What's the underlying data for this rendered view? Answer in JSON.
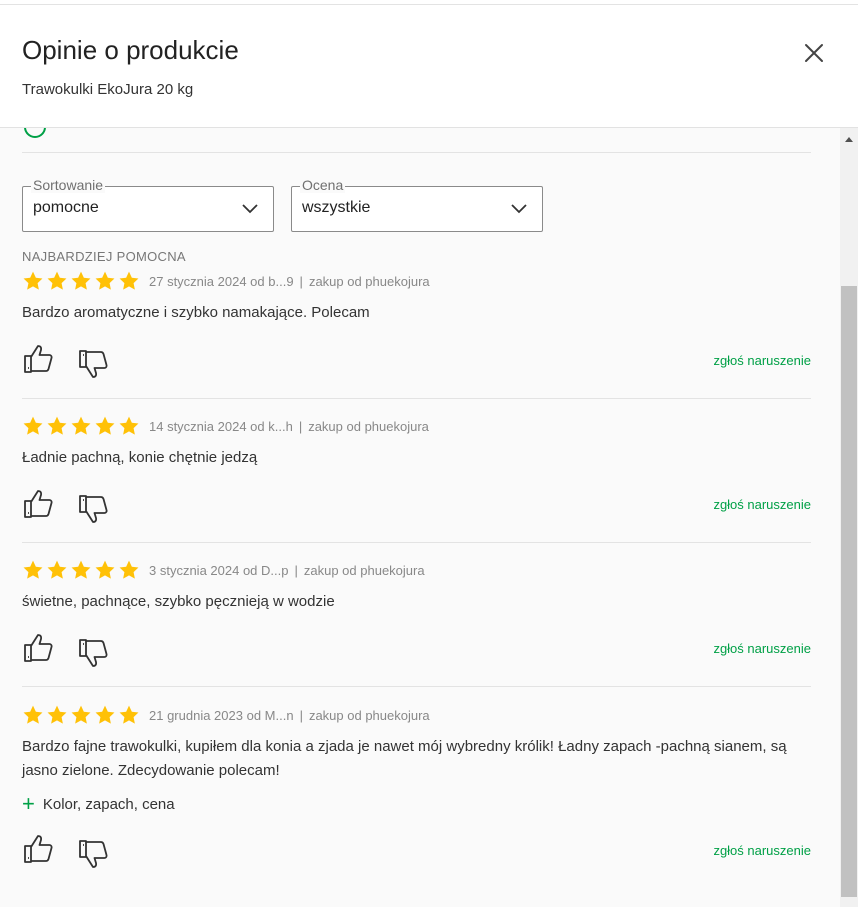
{
  "dialog": {
    "title": "Opinie o produkcie",
    "product_name": "Trawokulki EkoJura 20 kg"
  },
  "filters": {
    "sort": {
      "legend": "Sortowanie",
      "value": "pomocne"
    },
    "rating": {
      "legend": "Ocena",
      "value": "wszystkie"
    }
  },
  "section_label": "NAJBARDZIEJ POMOCNA",
  "colors": {
    "accent": "#00a046",
    "star": "#ffc107"
  },
  "reviews": [
    {
      "stars": 5,
      "date_author": "27 stycznia 2024 od b...9",
      "purchase": "zakup od phuekojura",
      "text": "Bardzo aromatyczne i szybko namakające. Polecam",
      "report": "zgłoś naruszenie"
    },
    {
      "stars": 5,
      "date_author": "14 stycznia 2024 od k...h",
      "purchase": "zakup od phuekojura",
      "text": "Ładnie pachną, konie chętnie jedzą",
      "report": "zgłoś naruszenie"
    },
    {
      "stars": 5,
      "date_author": "3 stycznia 2024 od D...p",
      "purchase": "zakup od phuekojura",
      "text": "świetne, pachnące, szybko pęcznieją w wodzie",
      "report": "zgłoś naruszenie"
    },
    {
      "stars": 5,
      "date_author": "21 grudnia 2023 od M...n",
      "purchase": "zakup od phuekojura",
      "text": "Bardzo fajne trawokulki, kupiłem dla konia a zjada je nawet mój wybredny królik! Ładny zapach -pachną sianem, są jasno zielone. Zdecydowanie polecam!",
      "pros": "Kolor, zapach, cena",
      "report": "zgłoś naruszenie"
    }
  ]
}
